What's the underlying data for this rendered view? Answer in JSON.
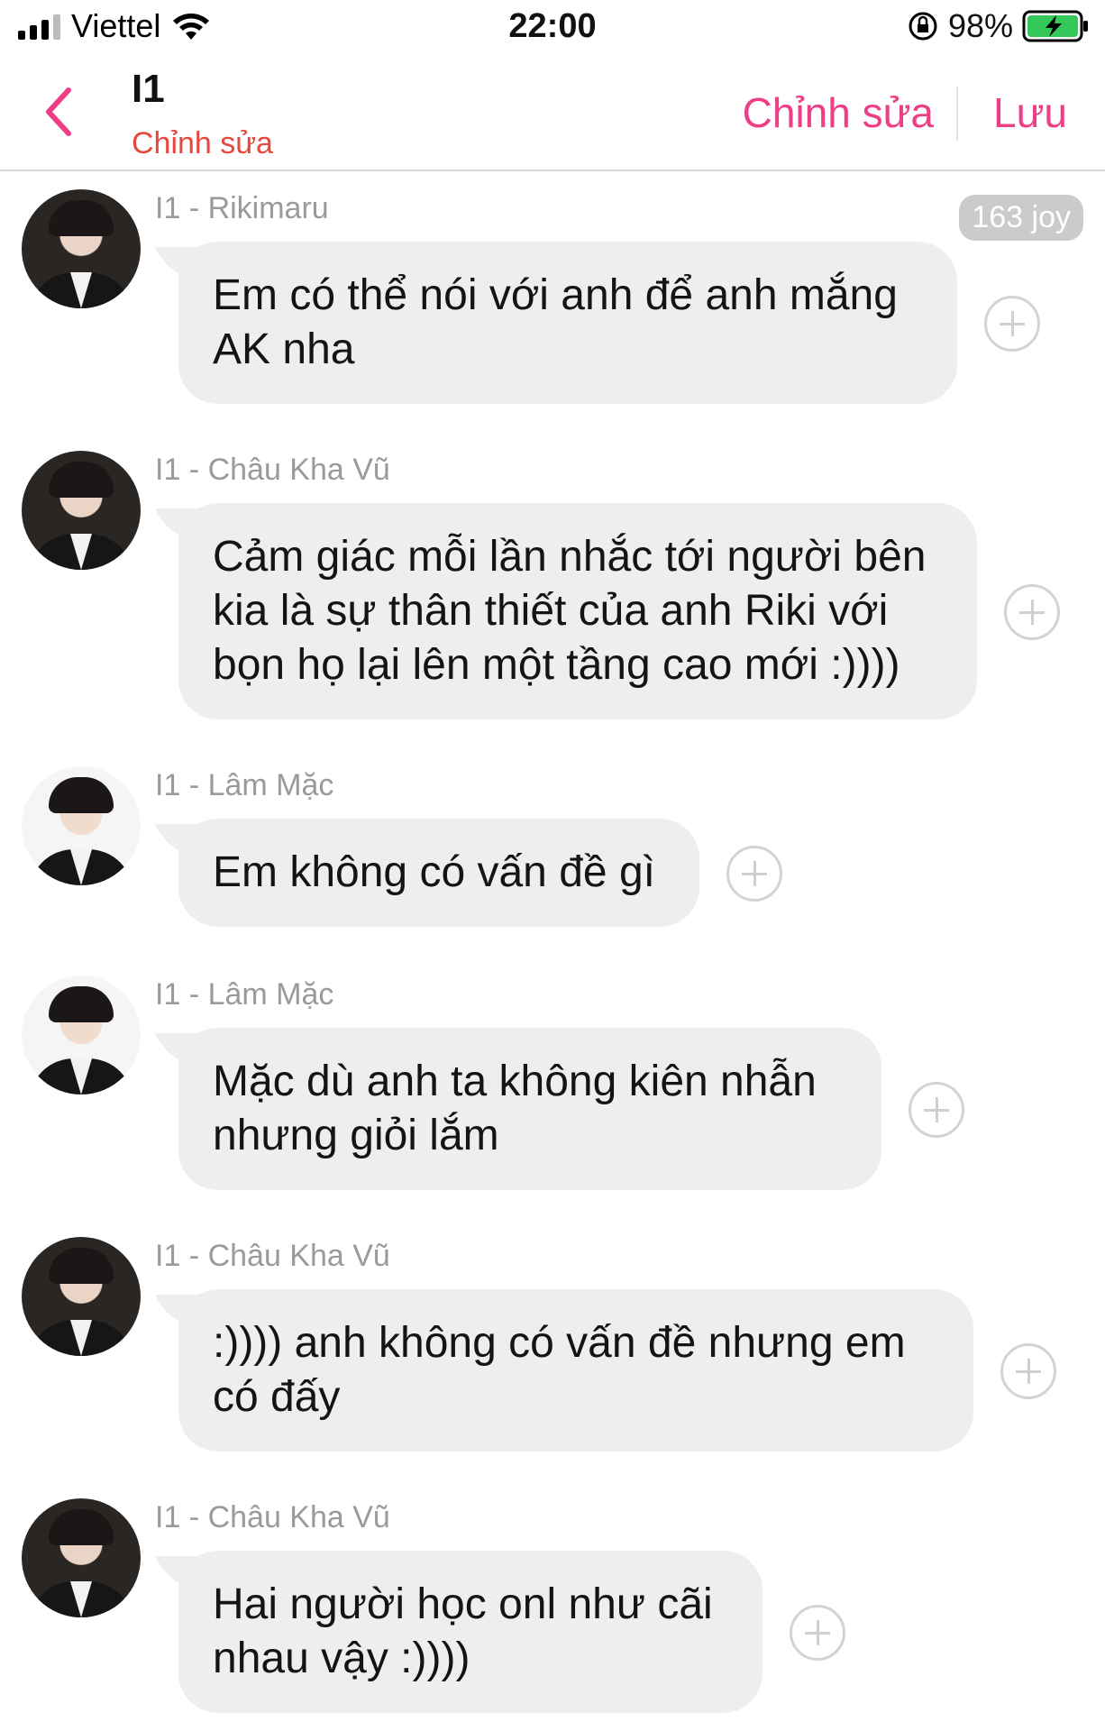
{
  "status": {
    "carrier": "Viettel",
    "time": "22:00",
    "battery": "98%",
    "icons": [
      "signal-icon",
      "wifi-icon",
      "rotation-lock-icon",
      "battery-charging-icon"
    ]
  },
  "header": {
    "title": "I1",
    "subtitle": "Chỉnh sửa",
    "edit_label": "Chỉnh sửa",
    "save_label": "Lưu",
    "accent": "#ee3f86",
    "subtitle_color": "#e8473c"
  },
  "joy_badge": "163 joy",
  "messages": [
    {
      "sender": "I1 - Rikimaru",
      "lines": [
        "Em có thể nói với anh để anh mắng",
        "AK nha"
      ]
    },
    {
      "sender": "I1 - Châu Kha Vũ",
      "lines": [
        "Cảm giác mỗi lần nhắc tới người bên",
        "kia là sự thân thiết của anh Riki với",
        "bọn họ lại lên một tầng cao mới :))))"
      ]
    },
    {
      "sender": "I1 - Lâm Mặc",
      "lines": [
        "Em không có vấn đề gì"
      ]
    },
    {
      "sender": "I1 - Lâm Mặc",
      "lines": [
        "Mặc dù anh ta không kiên nhẫn",
        "nhưng giỏi lắm"
      ]
    },
    {
      "sender": "I1 - Châu Kha Vũ",
      "lines": [
        ":)))) anh không có vấn đề nhưng em",
        "có đấy"
      ]
    },
    {
      "sender": "I1 - Châu Kha Vũ",
      "lines": [
        "Hai người học onl như cãi",
        "nhau vậy :))))"
      ]
    }
  ],
  "bubble_color": "#eceef0"
}
